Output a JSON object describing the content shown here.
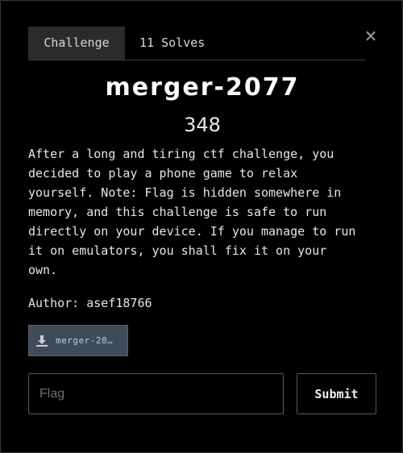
{
  "modal": {
    "close_label": "×",
    "tabs": [
      {
        "label": "Challenge",
        "active": true
      },
      {
        "label": "11 Solves",
        "active": false
      }
    ],
    "title": "merger-2077",
    "points": "348",
    "description": "After a long and tiring ctf challenge, you\ndecided to play a phone game to relax\nyourself. Note: Flag is hidden somewhere in\nmemory, and this challenge is safe to run\ndirectly on your device. If you manage to run\nit on emulators, you shall fix it on your\nown.",
    "author": "Author: asef18766",
    "file": {
      "label": "merger-20…",
      "icon": "download-icon"
    },
    "flag_input": {
      "placeholder": "Flag",
      "value": ""
    },
    "submit_label": "Submit"
  },
  "colors": {
    "background": "#000000",
    "active_tab": "#2b2b2b",
    "file_button": "#3f4b5a",
    "border": "#5a5a5a"
  }
}
